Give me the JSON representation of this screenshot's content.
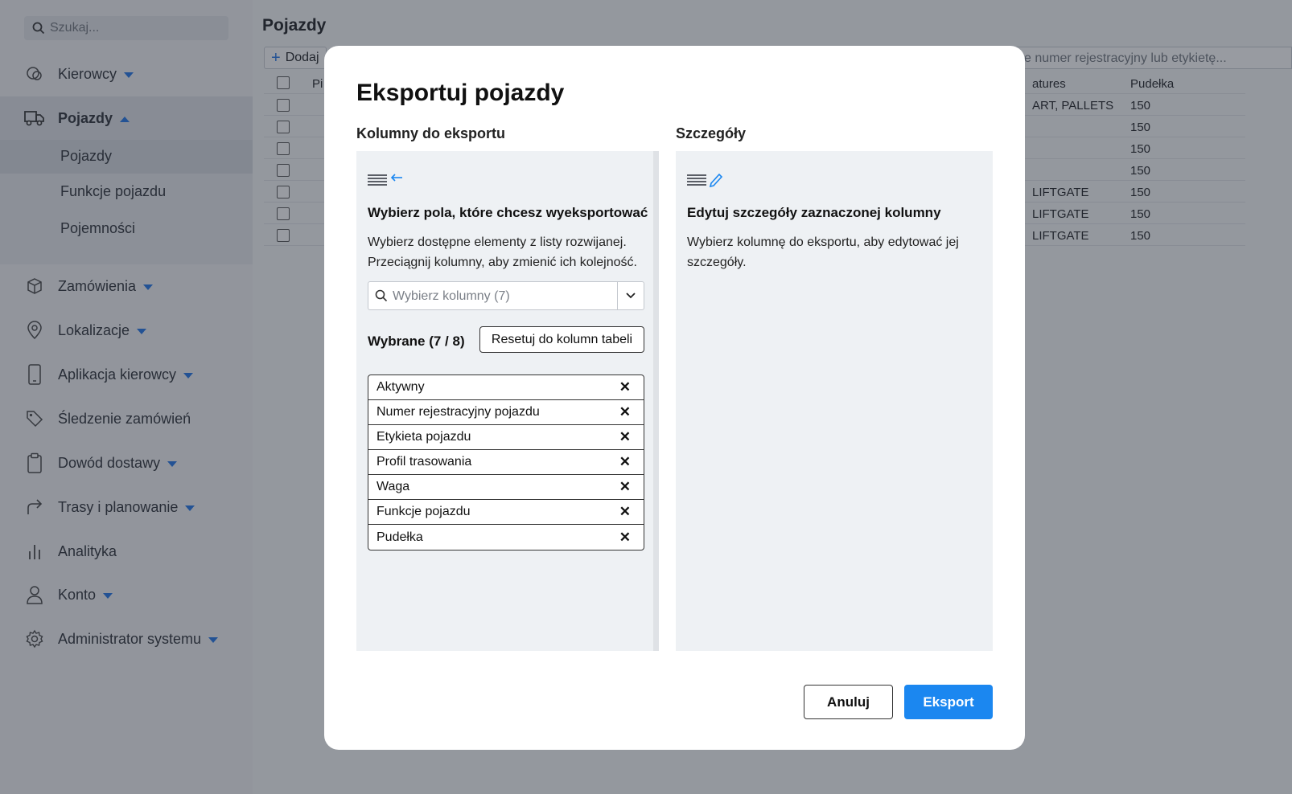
{
  "sidebar": {
    "search_placeholder": "Szukaj...",
    "items": [
      {
        "label": "Kierowcy",
        "icon": "steering-icon"
      },
      {
        "label": "Pojazdy",
        "icon": "truck-icon"
      },
      {
        "label": "Zamówienia",
        "icon": "box-icon"
      },
      {
        "label": "Lokalizacje",
        "icon": "pin-icon"
      },
      {
        "label": "Aplikacja kierowcy",
        "icon": "phone-icon"
      },
      {
        "label": "Śledzenie zamówień",
        "icon": "tag-icon"
      },
      {
        "label": "Dowód dostawy",
        "icon": "clipboard-icon"
      },
      {
        "label": "Trasy i planowanie",
        "icon": "route-icon"
      },
      {
        "label": "Analityka",
        "icon": "chart-icon"
      },
      {
        "label": "Konto",
        "icon": "user-icon"
      },
      {
        "label": "Administrator systemu",
        "icon": "gear-icon"
      }
    ],
    "sub_items": [
      "Pojazdy",
      "Funkcje pojazdu",
      "Pojemności"
    ]
  },
  "main": {
    "title": "Pojazdy",
    "add_label": "Dodaj",
    "filter_placeholder": "e numer rejestracyjny lub etykietę...",
    "columns": {
      "first": "Pi",
      "features": "atures",
      "boxes": "Pudełka"
    },
    "rows": [
      {
        "features": "ART, PALLETS",
        "boxes": "150"
      },
      {
        "features": "",
        "boxes": "150"
      },
      {
        "features": "",
        "boxes": "150"
      },
      {
        "features": "",
        "boxes": "150"
      },
      {
        "features": "LIFTGATE",
        "boxes": "150"
      },
      {
        "features": "LIFTGATE",
        "boxes": "150"
      },
      {
        "features": "LIFTGATE",
        "boxes": "150"
      }
    ]
  },
  "modal": {
    "title": "Eksportuj pojazdy",
    "left": {
      "heading": "Kolumny do eksportu",
      "panel_title": "Wybierz pola, które chcesz wyeksportować",
      "panel_text": "Wybierz dostępne elementy z listy rozwijanej. Przeciągnij kolumny, aby zmienić ich kolejność.",
      "select_placeholder": "Wybierz kolumny (7)",
      "selected_label": "Wybrane (7 / 8)",
      "reset_label": "Resetuj do kolumn tabeli",
      "chips": [
        "Aktywny",
        "Numer rejestracyjny pojazdu",
        "Etykieta pojazdu",
        "Profil trasowania",
        "Waga",
        "Funkcje pojazdu",
        "Pudełka"
      ]
    },
    "right": {
      "heading": "Szczegóły",
      "panel_title": "Edytuj szczegóły zaznaczonej kolumny",
      "panel_text": "Wybierz kolumnę do eksportu, aby edytować jej szczegóły."
    },
    "cancel_label": "Anuluj",
    "export_label": "Eksport"
  },
  "colors": {
    "accent": "#1b87f0",
    "nav_caret": "#1f74e6"
  }
}
